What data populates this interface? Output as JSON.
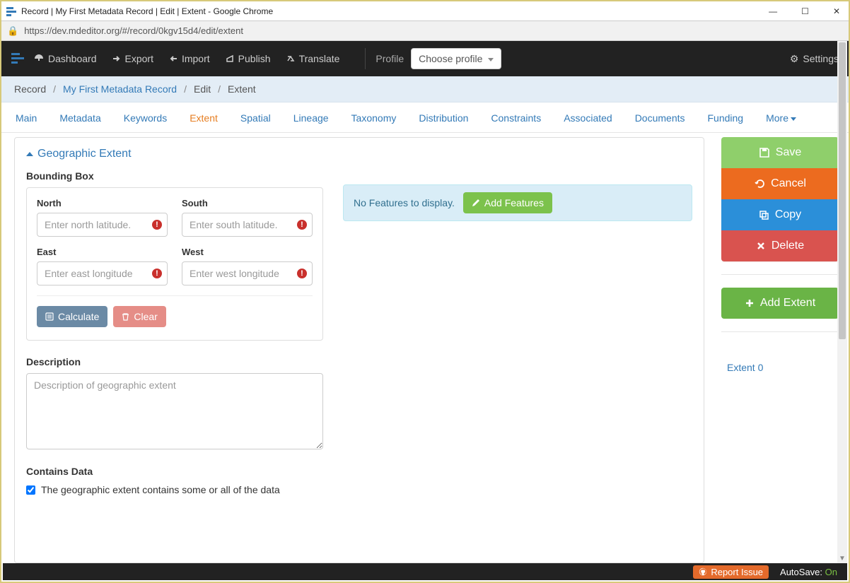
{
  "window": {
    "title": "Record | My First Metadata Record | Edit | Extent - Google Chrome",
    "url": "https://dev.mdeditor.org/#/record/0kgv15d4/edit/extent"
  },
  "navbar": {
    "dashboard": "Dashboard",
    "export": "Export",
    "import": "Import",
    "publish": "Publish",
    "translate": "Translate",
    "profile_label": "Profile",
    "profile_select": "Choose profile",
    "settings": "Settings"
  },
  "breadcrumb": {
    "record": "Record",
    "my_record": "My First Metadata Record",
    "edit": "Edit",
    "extent": "Extent"
  },
  "tabs": {
    "items": [
      "Main",
      "Metadata",
      "Keywords",
      "Extent",
      "Spatial",
      "Lineage",
      "Taxonomy",
      "Distribution",
      "Constraints",
      "Associated",
      "Documents",
      "Funding",
      "More"
    ],
    "active_index": 3
  },
  "panel": {
    "title": "Geographic Extent",
    "bbox_heading": "Bounding Box",
    "north_label": "North",
    "south_label": "South",
    "east_label": "East",
    "west_label": "West",
    "north_ph": "Enter north latitude.",
    "south_ph": "Enter south latitude.",
    "east_ph": "Enter east longitude",
    "west_ph": "Enter west longitude",
    "calculate": "Calculate",
    "clear": "Clear",
    "no_features": "No Features to display.",
    "add_features": "Add Features",
    "description_heading": "Description",
    "description_ph": "Description of geographic extent",
    "contains_heading": "Contains Data",
    "contains_text": "The geographic extent contains some or all of the data"
  },
  "sidebar": {
    "save": "Save",
    "cancel": "Cancel",
    "copy": "Copy",
    "delete": "Delete",
    "add_extent": "Add Extent",
    "extent_items": [
      "Extent 0"
    ]
  },
  "footer": {
    "report": "Report Issue",
    "autosave_label": "AutoSave:",
    "autosave_value": "On"
  }
}
